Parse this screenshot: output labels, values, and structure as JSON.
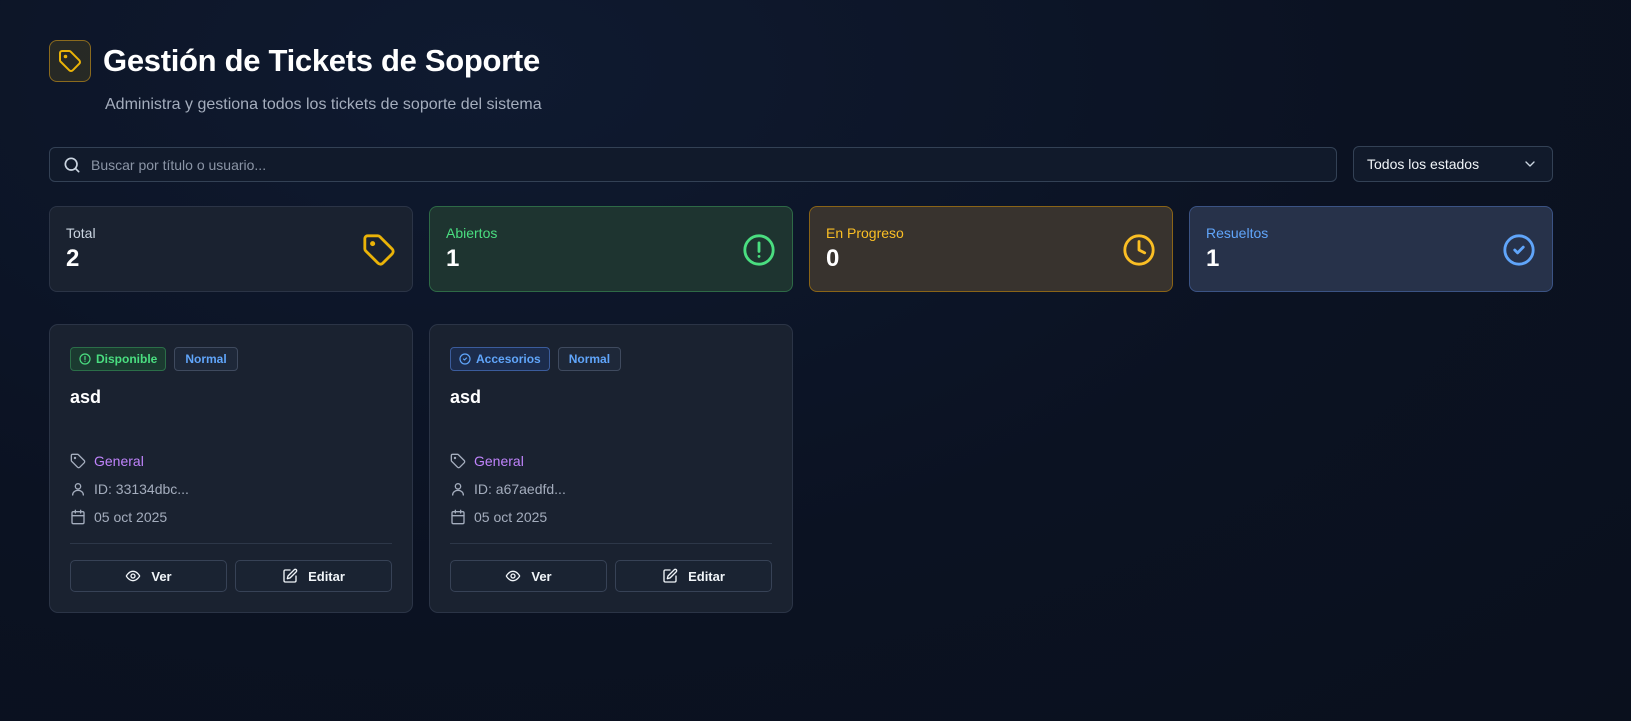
{
  "header": {
    "title": "Gestión de Tickets de Soporte",
    "subtitle": "Administra y gestiona todos los tickets de soporte del sistema",
    "logo_icon": "tag-icon"
  },
  "search": {
    "placeholder": "Buscar por título o usuario...",
    "value": ""
  },
  "status_filter": {
    "selected": "Todos los estados",
    "icon": "chevron-down-icon"
  },
  "stats": [
    {
      "label": "Total",
      "value": "2",
      "icon": "tag-icon",
      "color": "#eab308"
    },
    {
      "label": "Abiertos",
      "value": "1",
      "icon": "alert-circle-icon",
      "color": "#4ade80"
    },
    {
      "label": "En Progreso",
      "value": "0",
      "icon": "clock-icon",
      "color": "#fbbf24"
    },
    {
      "label": "Resueltos",
      "value": "1",
      "icon": "check-circle-icon",
      "color": "#60a5fa"
    }
  ],
  "tickets": [
    {
      "status_badge": "Disponible",
      "priority_badge": "Normal",
      "title": "asd",
      "category": "General",
      "user_id": "ID: 33134dbc...",
      "date": "05 oct 2025",
      "view_label": "Ver",
      "edit_label": "Editar"
    },
    {
      "status_badge": "Accesorios",
      "priority_badge": "Normal",
      "title": "asd",
      "category": "General",
      "user_id": "ID: a67aedfd...",
      "date": "05 oct 2025",
      "view_label": "Ver",
      "edit_label": "Editar"
    }
  ]
}
